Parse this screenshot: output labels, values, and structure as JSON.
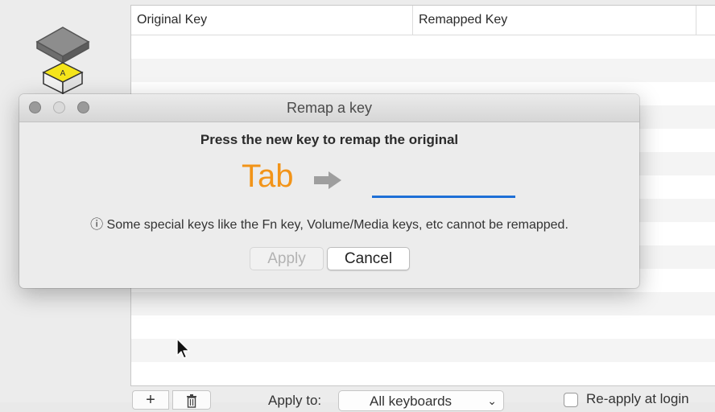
{
  "table": {
    "columns": [
      "Original Key",
      "Remapped Key"
    ]
  },
  "toolbar": {
    "add_label": "+",
    "apply_to_label": "Apply to:",
    "keyboards_value": "All keyboards",
    "reapply_label": "Re-apply at login"
  },
  "dialog": {
    "title": "Remap a key",
    "instruction": "Press the new key to remap the original",
    "original_key": "Tab",
    "info_note": "ⓘ Some special keys like the Fn key, Volume/Media keys, etc cannot be remapped.",
    "apply_label": "Apply",
    "cancel_label": "Cancel"
  },
  "colors": {
    "accent_orange": "#f29419",
    "slot_blue": "#1e6fd6"
  },
  "icons": [
    "app-keycap-icon",
    "right-arrow-icon",
    "trash-icon",
    "chevron-down-icon",
    "mouse-cursor-icon"
  ]
}
